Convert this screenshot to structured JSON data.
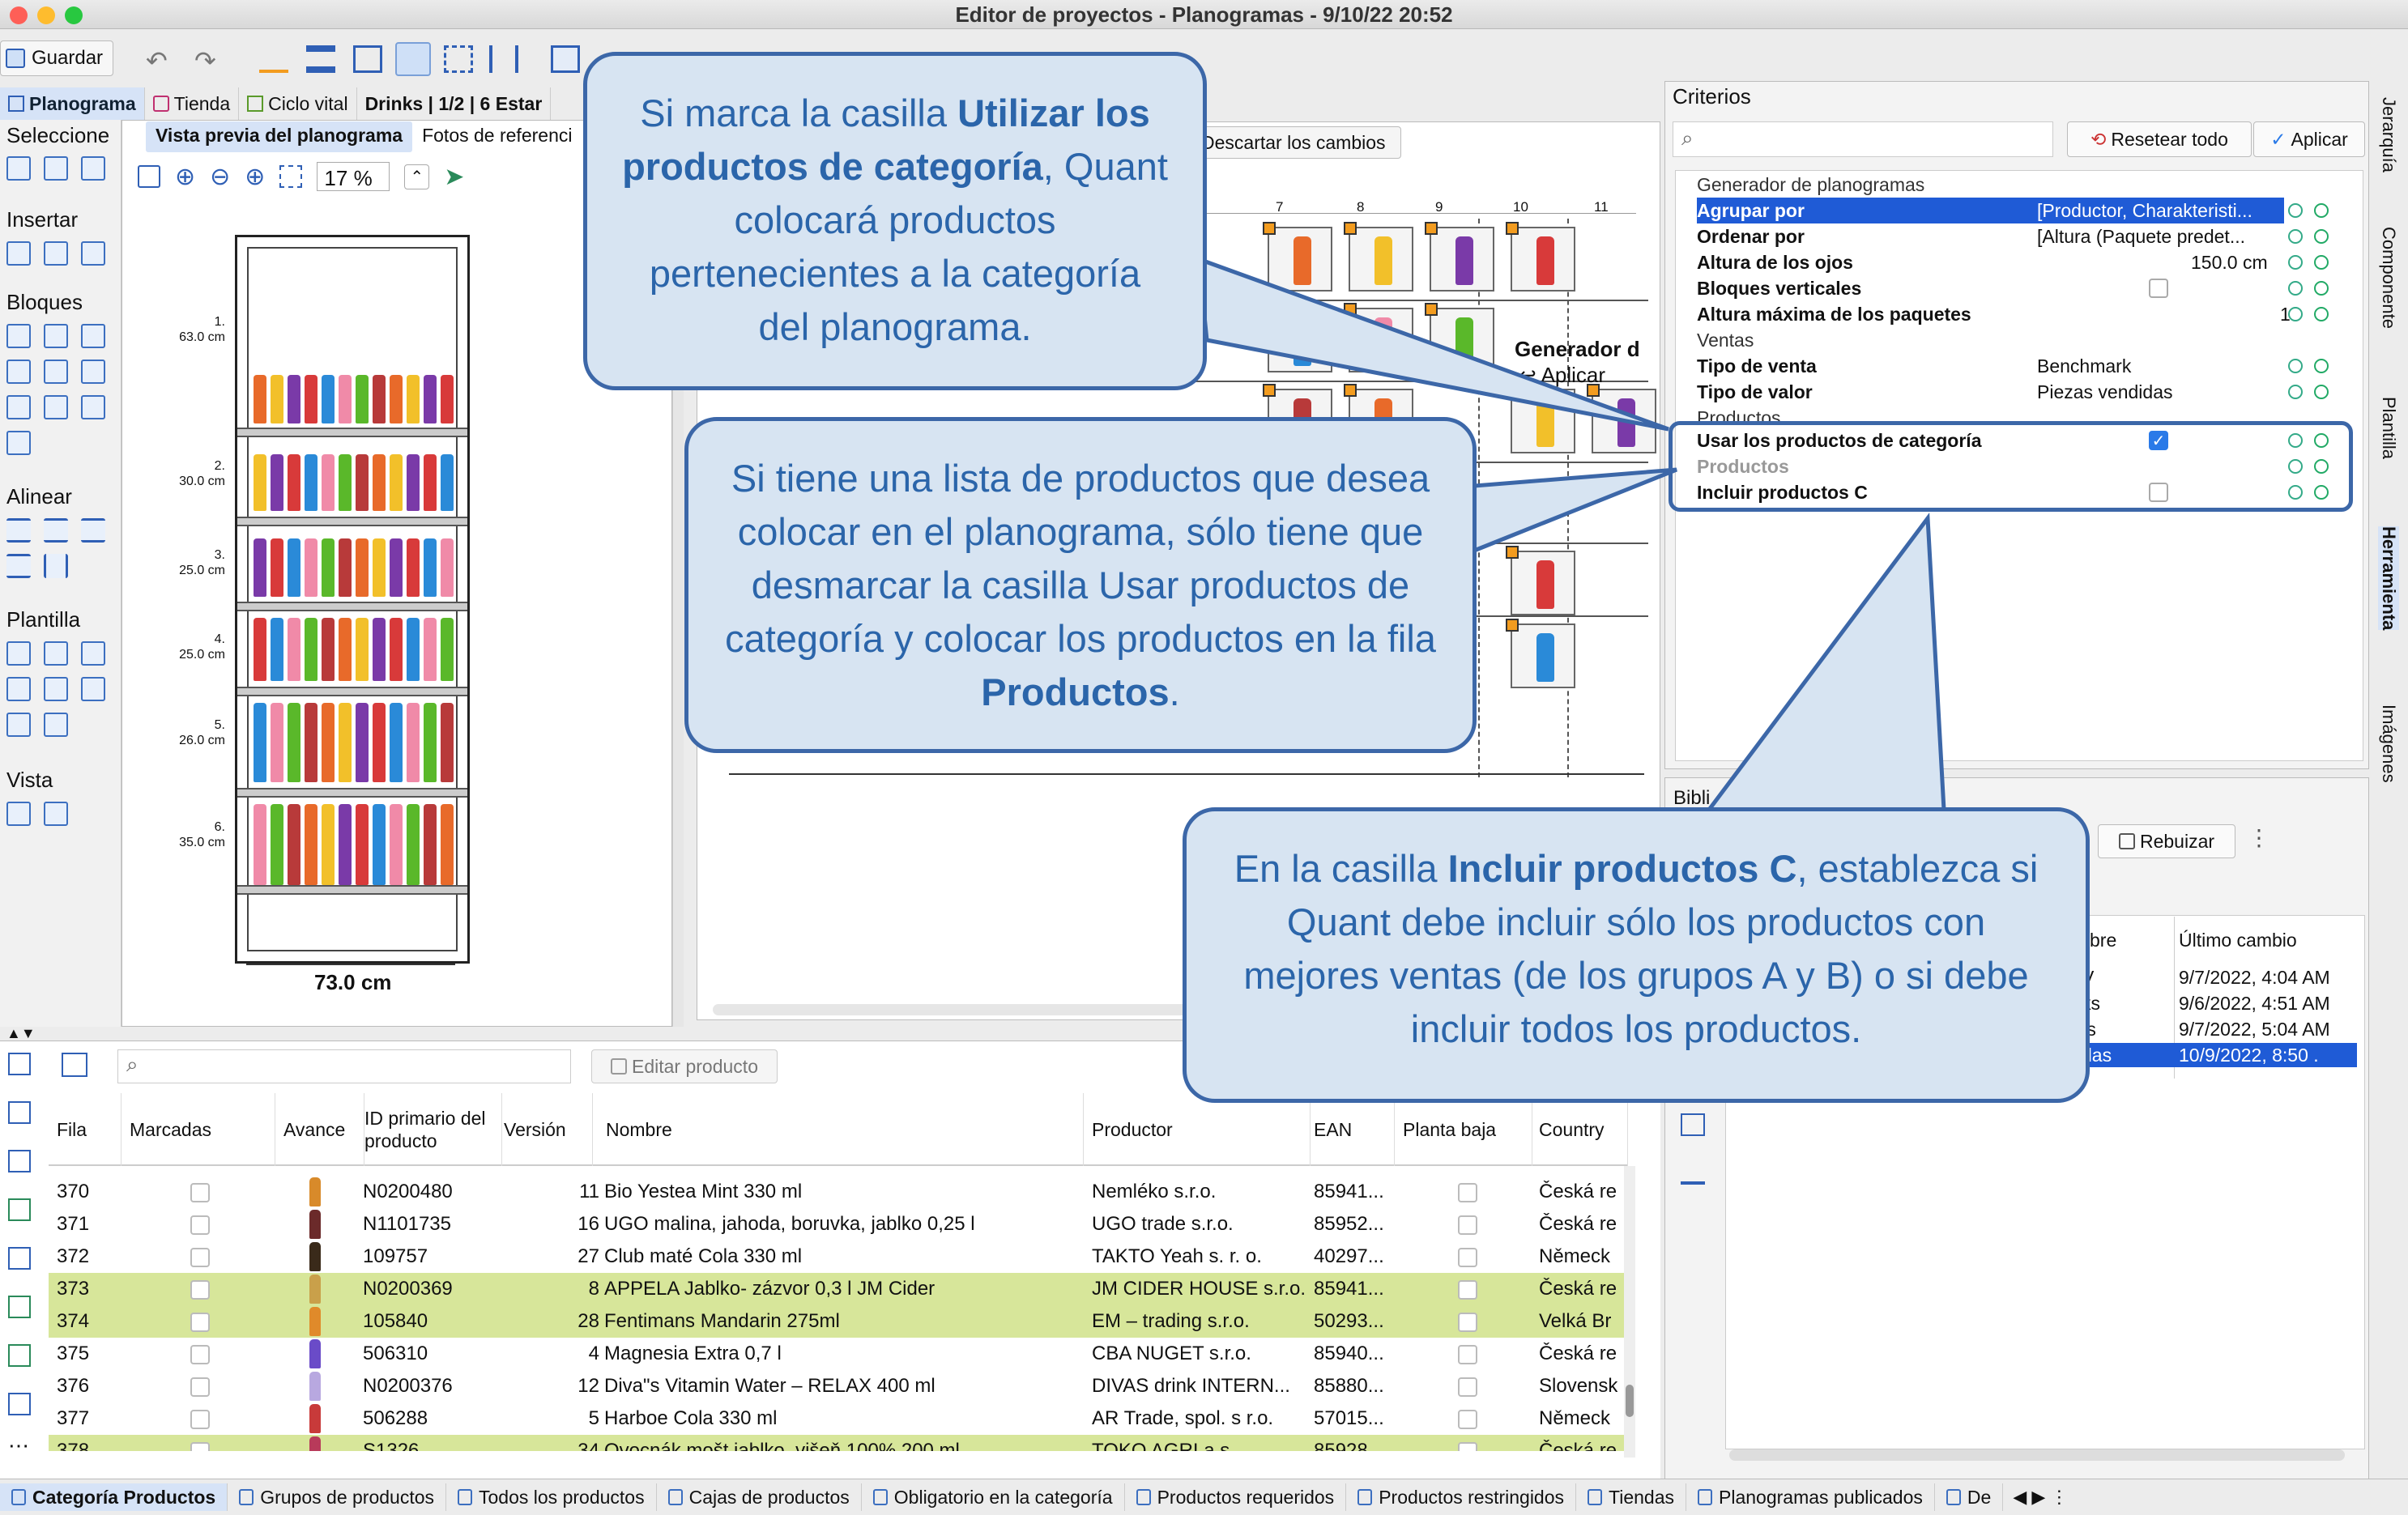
{
  "window": {
    "title": "Editor de proyectos - Planogramas - 9/10/22 20:52"
  },
  "toolbar": {
    "save_label": "Guardar"
  },
  "tabs": [
    {
      "label": "Planograma",
      "active": true
    },
    {
      "label": "Tienda"
    },
    {
      "label": "Ciclo vital"
    },
    {
      "label": "Drinks | 1/2 | 6 Estar"
    }
  ],
  "palette": {
    "select": "Seleccione",
    "insert": "Insertar",
    "blocks": "Bloques",
    "align": "Alinear",
    "template": "Plantilla",
    "view": "Vista"
  },
  "preview": {
    "tab_active": "Vista previa del planograma",
    "tab_photos": "Fotos de referenci",
    "zoom": "17 %",
    "width_label": "73.0 cm",
    "shelves": [
      {
        "num": "1.",
        "size": "63.0 cm"
      },
      {
        "num": "2.",
        "size": "30.0 cm"
      },
      {
        "num": "3.",
        "size": "25.0 cm"
      },
      {
        "num": "4.",
        "size": "25.0 cm"
      },
      {
        "num": "5.",
        "size": "26.0 cm"
      },
      {
        "num": "6.",
        "size": "35.0 cm"
      }
    ]
  },
  "center": {
    "discard_label": "Descartar los cambios",
    "columns": [
      "7",
      "8",
      "9",
      "10",
      "11"
    ],
    "generator_label": "Generador d",
    "apply_label": "Aplicar"
  },
  "criteria": {
    "title": "Criterios",
    "reset_label": "Resetear todo",
    "apply_label": "Aplicar",
    "section_generator": "Generador de planogramas",
    "rows": [
      {
        "key": "Agrupar por",
        "value": "[Productor, Charakteristi..."
      },
      {
        "key": "Ordenar por",
        "value": "[Altura (Paquete predet..."
      },
      {
        "key": "Altura de los ojos",
        "value": "150.0 cm"
      },
      {
        "key": "Bloques verticales",
        "value": ""
      },
      {
        "key": "Altura máxima de los paquetes",
        "value": "1"
      }
    ],
    "section_sales": "Ventas",
    "sales_rows": [
      {
        "key": "Tipo de venta",
        "value": "Benchmark"
      },
      {
        "key": "Tipo de valor",
        "value": "Piezas vendidas"
      }
    ],
    "section_products": "Productos",
    "use_category": "Usar los productos de categoría",
    "products_sub": "Productos",
    "include_c": "Incluir productos C"
  },
  "side_tabs": [
    "Jerarquía",
    "Componente",
    "Plantilla",
    "Herramienta",
    "Imágenes"
  ],
  "library": {
    "title": "Bibli",
    "rebuild_label": "Rebuizar",
    "col_name": "bre",
    "col_changed": "Último cambio",
    "rows": [
      {
        "name": "V",
        "changed": "9/7/2022, 4:04 AM"
      },
      {
        "name": "ks",
        "changed": "9/6/2022, 4:51 AM"
      },
      {
        "name": "ts",
        "changed": "9/7/2022, 5:04 AM"
      },
      {
        "name": "das",
        "changed": "10/9/2022, 8:50 ."
      }
    ]
  },
  "bottom": {
    "edit_label": "Editar producto",
    "headers": [
      "Fila",
      "Marcadas",
      "Avance",
      "ID primario del producto",
      "Versión",
      "Nombre",
      "Productor",
      "EAN",
      "Planta baja",
      "Country"
    ],
    "rows": [
      {
        "fila": "370",
        "id": "N0200480",
        "ver": "11",
        "name": "Bio Yestea Mint 330 ml",
        "prod": "Nemléko s.r.o.",
        "ean": "85941...",
        "country": "Česká re",
        "hl": false,
        "color": "#d88a2a"
      },
      {
        "fila": "371",
        "id": "N1101735",
        "ver": "16",
        "name": "UGO malina, jahoda, boruvka, jablko 0,25 l",
        "prod": "UGO trade s.r.o.",
        "ean": "85952...",
        "country": "Česká re",
        "hl": false,
        "color": "#6b2a2a"
      },
      {
        "fila": "372",
        "id": "109757",
        "ver": "27",
        "name": "Club maté Cola 330 ml",
        "prod": "TAKTO Yeah s. r. o.",
        "ean": "40297...",
        "country": "Německ",
        "hl": false,
        "color": "#3a2a1a"
      },
      {
        "fila": "373",
        "id": "N0200369",
        "ver": "8",
        "name": "APPELA Jablko- zázvor 0,3 l JM Cider",
        "prod": "JM CIDER HOUSE s.r.o.",
        "ean": "85941...",
        "country": "Česká re",
        "hl": true,
        "color": "#c9a04a"
      },
      {
        "fila": "374",
        "id": "105840",
        "ver": "28",
        "name": "Fentimans Mandarin 275ml",
        "prod": "EM – trading s.r.o.",
        "ean": "50293...",
        "country": "Velká Br",
        "hl": true,
        "color": "#e08a2a"
      },
      {
        "fila": "375",
        "id": "506310",
        "ver": "4",
        "name": "Magnesia Extra 0,7 l",
        "prod": "CBA NUGET s.r.o.",
        "ean": "85940...",
        "country": "Česká re",
        "hl": false,
        "color": "#6a4bc8"
      },
      {
        "fila": "376",
        "id": "N0200376",
        "ver": "12",
        "name": "Diva\"s Vitamin Water – RELAX 400 ml",
        "prod": "DIVAS drink INTERN...",
        "ean": "85880...",
        "country": "Slovensk",
        "hl": false,
        "color": "#b8a8e0"
      },
      {
        "fila": "377",
        "id": "506288",
        "ver": "5",
        "name": "Harboe Cola 330 ml",
        "prod": "AR Trade, spol. s r.o.",
        "ean": "57015...",
        "country": "Německ",
        "hl": false,
        "color": "#c83a3a"
      },
      {
        "fila": "378",
        "id": "S1326",
        "ver": "34",
        "name": "Ovocnák mošt jablko, višeň 100% 200 ml",
        "prod": "TOKO AGRI a.s.",
        "ean": "85928...",
        "country": "Česká re",
        "hl": true,
        "color": "#b83a5a"
      }
    ]
  },
  "statusbar": [
    {
      "label": "Categoría Productos",
      "active": true
    },
    {
      "label": "Grupos de productos"
    },
    {
      "label": "Todos los productos"
    },
    {
      "label": "Cajas de productos"
    },
    {
      "label": "Obligatorio en la categoría"
    },
    {
      "label": "Productos requeridos"
    },
    {
      "label": "Productos restringidos"
    },
    {
      "label": "Tiendas"
    },
    {
      "label": "Planogramas publicados"
    },
    {
      "label": "De"
    }
  ],
  "callouts": {
    "c1": {
      "pre": "Si marca la casilla ",
      "bold": "Utilizar los productos de categoría",
      "post": ", Quant colocará productos pertenecientes a la categoría del planograma."
    },
    "c2": {
      "pre": "Si tiene una lista de productos que desea colocar en el planograma, sólo tiene que desmarcar la casilla Usar productos de categoría y colocar los productos en la fila ",
      "bold": "Productos",
      "post": "."
    },
    "c3": {
      "pre": "En la casilla ",
      "bold": "Incluir productos C",
      "post": ", establezca si Quant debe incluir sólo los productos con mejores ventas (de los grupos A y B) o si debe incluir todos los productos."
    }
  }
}
